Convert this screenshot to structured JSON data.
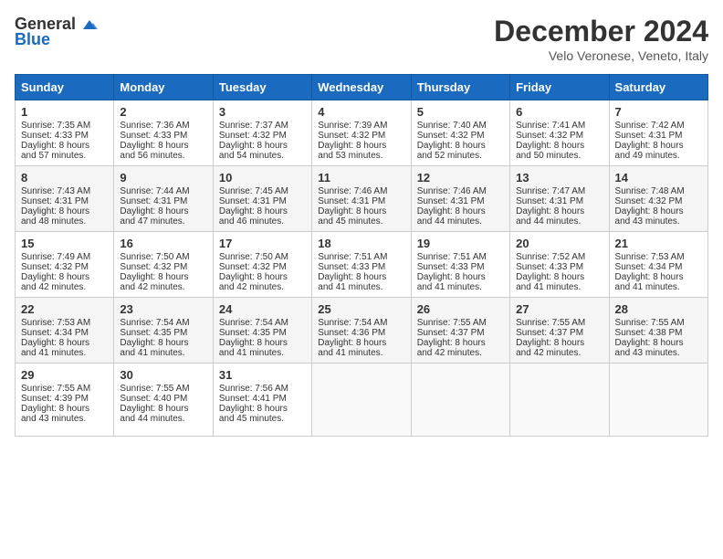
{
  "header": {
    "logo_general": "General",
    "logo_blue": "Blue",
    "title": "December 2024",
    "subtitle": "Velo Veronese, Veneto, Italy"
  },
  "weekdays": [
    "Sunday",
    "Monday",
    "Tuesday",
    "Wednesday",
    "Thursday",
    "Friday",
    "Saturday"
  ],
  "weeks": [
    [
      {
        "day": "1",
        "sunrise": "7:35 AM",
        "sunset": "4:33 PM",
        "daylight": "8 hours and 57 minutes."
      },
      {
        "day": "2",
        "sunrise": "7:36 AM",
        "sunset": "4:33 PM",
        "daylight": "8 hours and 56 minutes."
      },
      {
        "day": "3",
        "sunrise": "7:37 AM",
        "sunset": "4:32 PM",
        "daylight": "8 hours and 54 minutes."
      },
      {
        "day": "4",
        "sunrise": "7:39 AM",
        "sunset": "4:32 PM",
        "daylight": "8 hours and 53 minutes."
      },
      {
        "day": "5",
        "sunrise": "7:40 AM",
        "sunset": "4:32 PM",
        "daylight": "8 hours and 52 minutes."
      },
      {
        "day": "6",
        "sunrise": "7:41 AM",
        "sunset": "4:32 PM",
        "daylight": "8 hours and 50 minutes."
      },
      {
        "day": "7",
        "sunrise": "7:42 AM",
        "sunset": "4:31 PM",
        "daylight": "8 hours and 49 minutes."
      }
    ],
    [
      {
        "day": "8",
        "sunrise": "7:43 AM",
        "sunset": "4:31 PM",
        "daylight": "8 hours and 48 minutes."
      },
      {
        "day": "9",
        "sunrise": "7:44 AM",
        "sunset": "4:31 PM",
        "daylight": "8 hours and 47 minutes."
      },
      {
        "day": "10",
        "sunrise": "7:45 AM",
        "sunset": "4:31 PM",
        "daylight": "8 hours and 46 minutes."
      },
      {
        "day": "11",
        "sunrise": "7:46 AM",
        "sunset": "4:31 PM",
        "daylight": "8 hours and 45 minutes."
      },
      {
        "day": "12",
        "sunrise": "7:46 AM",
        "sunset": "4:31 PM",
        "daylight": "8 hours and 44 minutes."
      },
      {
        "day": "13",
        "sunrise": "7:47 AM",
        "sunset": "4:31 PM",
        "daylight": "8 hours and 44 minutes."
      },
      {
        "day": "14",
        "sunrise": "7:48 AM",
        "sunset": "4:32 PM",
        "daylight": "8 hours and 43 minutes."
      }
    ],
    [
      {
        "day": "15",
        "sunrise": "7:49 AM",
        "sunset": "4:32 PM",
        "daylight": "8 hours and 42 minutes."
      },
      {
        "day": "16",
        "sunrise": "7:50 AM",
        "sunset": "4:32 PM",
        "daylight": "8 hours and 42 minutes."
      },
      {
        "day": "17",
        "sunrise": "7:50 AM",
        "sunset": "4:32 PM",
        "daylight": "8 hours and 42 minutes."
      },
      {
        "day": "18",
        "sunrise": "7:51 AM",
        "sunset": "4:33 PM",
        "daylight": "8 hours and 41 minutes."
      },
      {
        "day": "19",
        "sunrise": "7:51 AM",
        "sunset": "4:33 PM",
        "daylight": "8 hours and 41 minutes."
      },
      {
        "day": "20",
        "sunrise": "7:52 AM",
        "sunset": "4:33 PM",
        "daylight": "8 hours and 41 minutes."
      },
      {
        "day": "21",
        "sunrise": "7:53 AM",
        "sunset": "4:34 PM",
        "daylight": "8 hours and 41 minutes."
      }
    ],
    [
      {
        "day": "22",
        "sunrise": "7:53 AM",
        "sunset": "4:34 PM",
        "daylight": "8 hours and 41 minutes."
      },
      {
        "day": "23",
        "sunrise": "7:54 AM",
        "sunset": "4:35 PM",
        "daylight": "8 hours and 41 minutes."
      },
      {
        "day": "24",
        "sunrise": "7:54 AM",
        "sunset": "4:35 PM",
        "daylight": "8 hours and 41 minutes."
      },
      {
        "day": "25",
        "sunrise": "7:54 AM",
        "sunset": "4:36 PM",
        "daylight": "8 hours and 41 minutes."
      },
      {
        "day": "26",
        "sunrise": "7:55 AM",
        "sunset": "4:37 PM",
        "daylight": "8 hours and 42 minutes."
      },
      {
        "day": "27",
        "sunrise": "7:55 AM",
        "sunset": "4:37 PM",
        "daylight": "8 hours and 42 minutes."
      },
      {
        "day": "28",
        "sunrise": "7:55 AM",
        "sunset": "4:38 PM",
        "daylight": "8 hours and 43 minutes."
      }
    ],
    [
      {
        "day": "29",
        "sunrise": "7:55 AM",
        "sunset": "4:39 PM",
        "daylight": "8 hours and 43 minutes."
      },
      {
        "day": "30",
        "sunrise": "7:55 AM",
        "sunset": "4:40 PM",
        "daylight": "8 hours and 44 minutes."
      },
      {
        "day": "31",
        "sunrise": "7:56 AM",
        "sunset": "4:41 PM",
        "daylight": "8 hours and 45 minutes."
      },
      null,
      null,
      null,
      null
    ]
  ],
  "labels": {
    "sunrise": "Sunrise:",
    "sunset": "Sunset:",
    "daylight": "Daylight:"
  }
}
